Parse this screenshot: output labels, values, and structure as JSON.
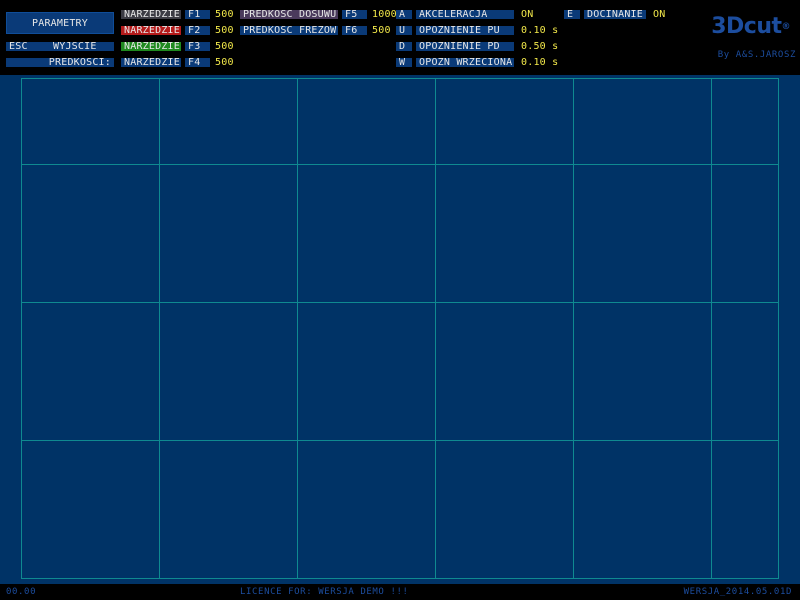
{
  "header": {
    "parametry_label": "PARAMETRY",
    "esc_key": "ESC",
    "wyjscie_label": "WYJSCIE",
    "predkosci_label": "PREDKOSCI:",
    "tools": [
      {
        "label": "NARZEDZIE",
        "key": "F1",
        "value": "500"
      },
      {
        "label": "NARZEDZIE",
        "key": "F2",
        "value": "500"
      },
      {
        "label": "NARZEDZIE",
        "key": "F3",
        "value": "500"
      },
      {
        "label": "NARZEDZIE",
        "key": "F4",
        "value": "500"
      }
    ],
    "speeds": [
      {
        "label": "PREDKOSC DOSUWU",
        "key": "F5",
        "value": "1000"
      },
      {
        "label": "PREDKOSC FREZOW",
        "key": "F6",
        "value": "500"
      }
    ],
    "options": [
      {
        "key": "A",
        "label": "AKCELERACJA",
        "value": "ON"
      },
      {
        "key": "U",
        "label": "OPOZNIENIE PU",
        "value": "0.10 s"
      },
      {
        "key": "D",
        "label": "OPOZNIENIE PD",
        "value": "0.50 s"
      },
      {
        "key": "W",
        "label": "OPOZN WRZECIONA",
        "value": "0.10 s"
      }
    ],
    "docinanie": {
      "key": "E",
      "label": "DOCINANIE",
      "value": "ON"
    },
    "logo_text": "3Dcut",
    "logo_mark": "®",
    "logo_sub": "By A&S.JAROSZ"
  },
  "status": {
    "coords": "00.00",
    "licence": "LICENCE FOR: WERSJA DEMO !!!",
    "version": "WERSJA_2014.05.01D"
  },
  "colors": {
    "workarea": "#003366",
    "grid": "#0f8a90",
    "panel_blue": "#0a3a78",
    "value_yellow": "#f2e84a",
    "tool_f1": "#3c3c44",
    "tool_f2": "#b51a1a",
    "tool_f3": "#1f8a1f",
    "tool_f4": "#0a3a78"
  }
}
